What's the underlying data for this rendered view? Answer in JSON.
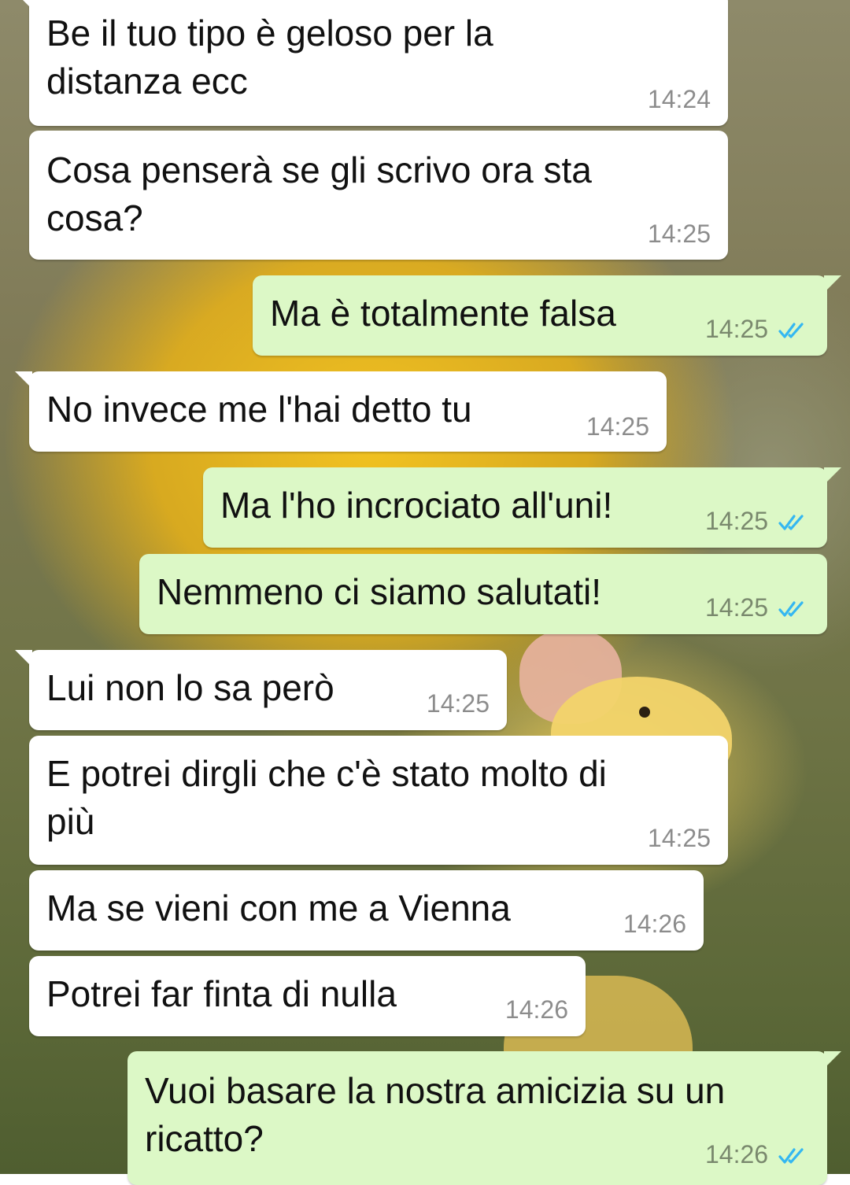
{
  "messages": [
    {
      "direction": "in",
      "text": "Be il tuo tipo è geloso per la\ndistanza ecc",
      "time": "14:24"
    },
    {
      "direction": "in",
      "text": "Cosa penserà se gli scrivo ora sta\ncosa?",
      "time": "14:25"
    },
    {
      "direction": "out",
      "text": "Ma è totalmente falsa",
      "time": "14:25",
      "status": "read"
    },
    {
      "direction": "in",
      "text": "No invece me l'hai detto tu",
      "time": "14:25"
    },
    {
      "direction": "out",
      "text": "Ma l'ho incrociato all'uni!",
      "time": "14:25",
      "status": "read"
    },
    {
      "direction": "out",
      "text": "Nemmeno ci siamo salutati!",
      "time": "14:25",
      "status": "read"
    },
    {
      "direction": "in",
      "text": "Lui non lo sa però",
      "time": "14:25"
    },
    {
      "direction": "in",
      "text": "E potrei dirgli che c'è stato molto di\npiù",
      "time": "14:25"
    },
    {
      "direction": "in",
      "text": "Ma se vieni con me a Vienna",
      "time": "14:26"
    },
    {
      "direction": "in",
      "text": "Potrei far finta di nulla",
      "time": "14:26"
    },
    {
      "direction": "out",
      "text": "Vuoi basare la nostra amicizia su un\nricatto?",
      "time": "14:26",
      "status": "read"
    }
  ],
  "colors": {
    "incoming_bubble": "#ffffff",
    "outgoing_bubble": "#dcf8c6",
    "read_ticks": "#34b7f1",
    "timestamp": "#8c8c8c"
  },
  "icons": {
    "read_status": "double-check-icon"
  }
}
